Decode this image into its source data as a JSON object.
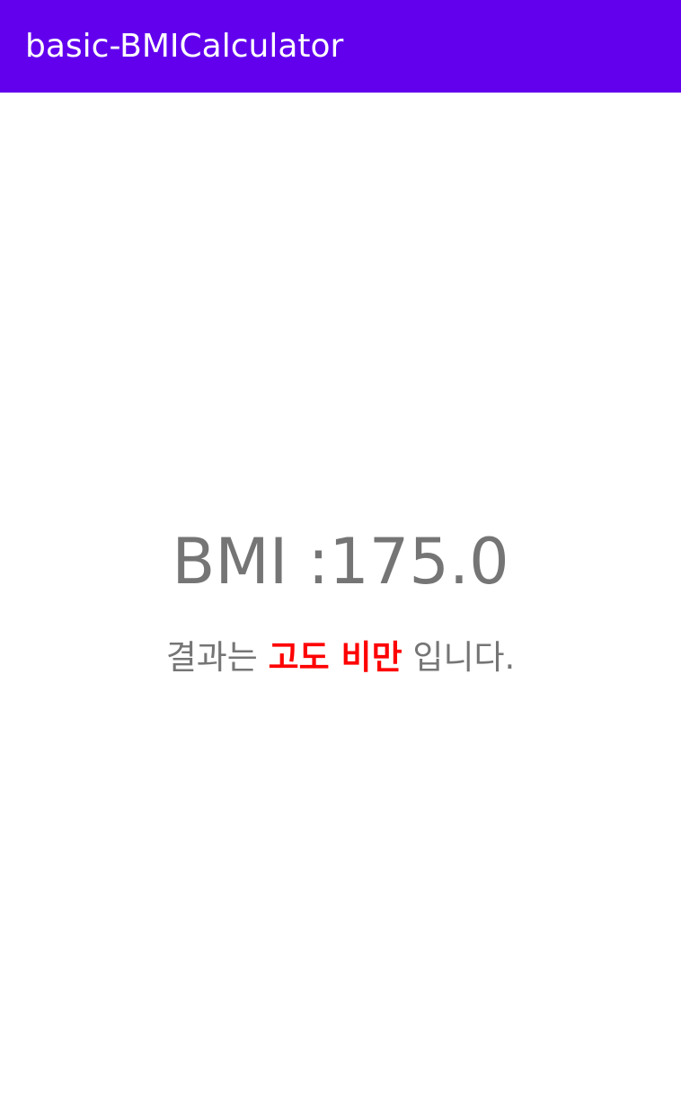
{
  "app_bar": {
    "title": "basic-BMICalculator",
    "background_color": "#6200EE",
    "title_color": "#FFFFFF"
  },
  "result": {
    "bmi_label": "BMI :",
    "bmi_value": "175.0",
    "text_prefix": "결과는",
    "category": "고도 비만",
    "text_suffix": "입니다.",
    "text_color": "#757575",
    "category_color": "#FF0000"
  }
}
